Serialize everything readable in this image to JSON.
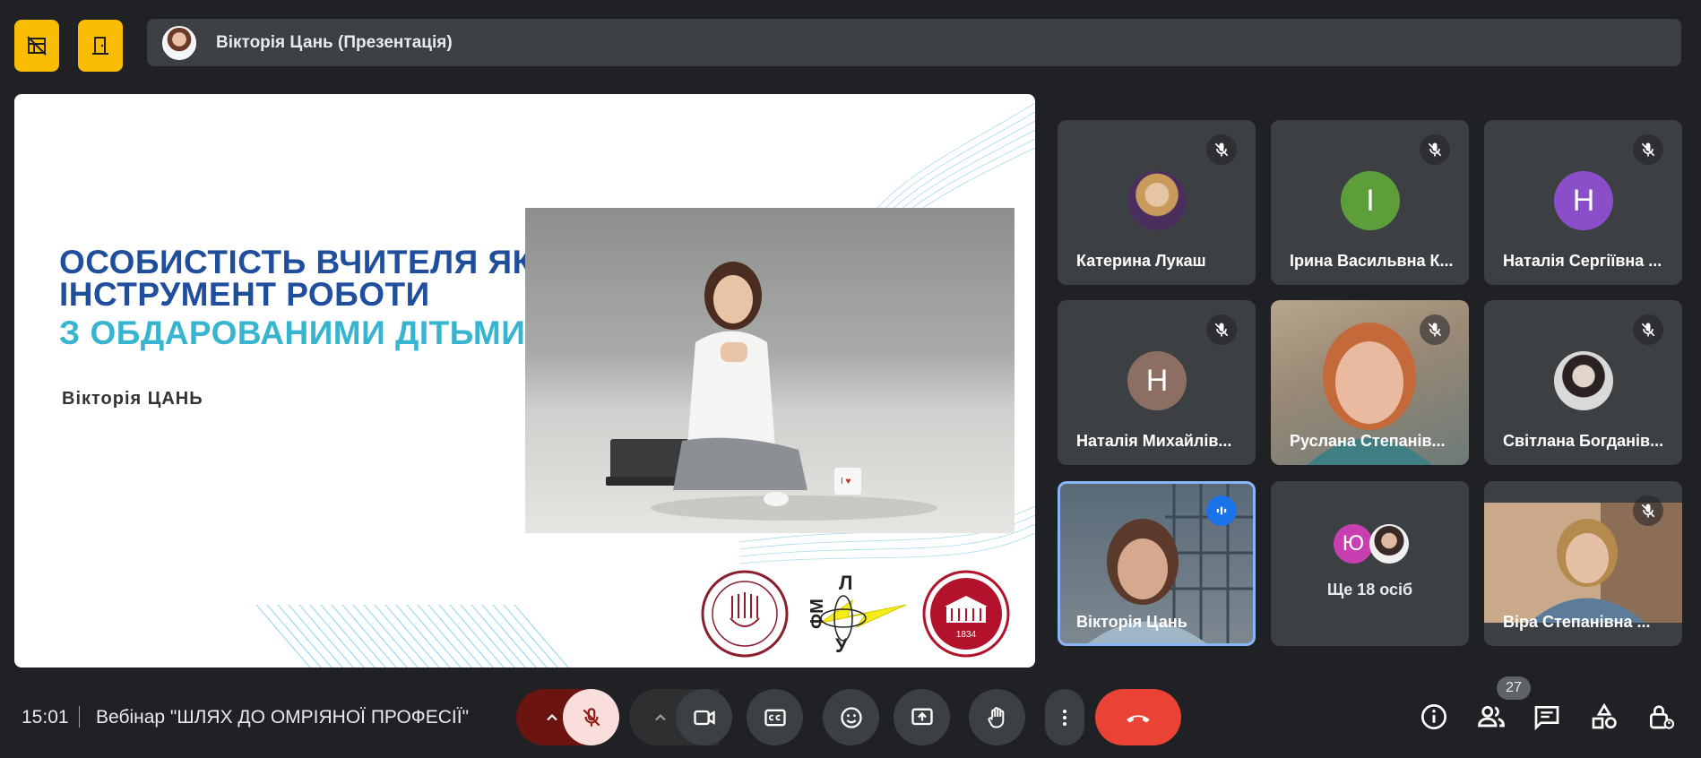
{
  "presenter": {
    "name": "Вікторія Цань (Презентація)"
  },
  "slide": {
    "title_line1": "ОСОБИСТІСТЬ ВЧИТЕЛЯ ЯК",
    "title_line2": "ІНСТРУМЕНТ РОБОТИ",
    "title_line3": "З ОБДАРОВАНИМИ ДІТЬМИ",
    "author": "Вікторія ЦАНЬ",
    "logo_year": "1834",
    "logo_mid_letters": [
      "Л",
      "ФМ",
      "У"
    ]
  },
  "participants": [
    {
      "name": "Катерина Лукаш",
      "avatar": "photo",
      "muted": true
    },
    {
      "name": "Ірина Васильвна К...",
      "letter": "І",
      "color": "#5d9e3a",
      "muted": true
    },
    {
      "name": "Наталія Сергіївна ...",
      "letter": "Н",
      "color": "#8a4fc8",
      "muted": true
    },
    {
      "name": "Наталія Михайлів...",
      "letter": "Н",
      "color": "#8d6e63",
      "muted": true
    },
    {
      "name": "Руслана Степанів...",
      "avatar": "video",
      "muted": true
    },
    {
      "name": "Світлана Богданів...",
      "avatar": "photo",
      "muted": true
    },
    {
      "name": "Вікторія Цань",
      "avatar": "video",
      "speaking": true
    },
    {
      "more_label": "Ще 18 осіб",
      "letter": "Ю",
      "color": "#c73fb1"
    },
    {
      "name": "Віра Степанівна ...",
      "avatar": "video",
      "muted": true
    }
  ],
  "bottom": {
    "time": "15:01",
    "meeting_title": "Вебінар \"ШЛЯХ ДО ОМРІЯНОЇ ПРОФЕСІЇ\"",
    "people_count": "27"
  },
  "colors": {
    "accent_yellow": "#fbbc04",
    "end_call_red": "#ea4335",
    "mic_off_pink": "#f9dedc",
    "speaking_blue": "#8ab4f8"
  }
}
